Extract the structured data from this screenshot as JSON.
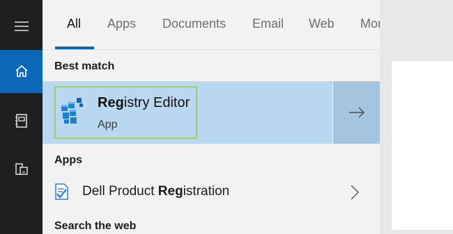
{
  "rail": {
    "items": [
      "menu-icon",
      "home-icon",
      "notebook-icon",
      "devices-icon"
    ]
  },
  "tabs": [
    {
      "label": "All"
    },
    {
      "label": "Apps"
    },
    {
      "label": "Documents"
    },
    {
      "label": "Email"
    },
    {
      "label": "Web"
    },
    {
      "label": "More"
    }
  ],
  "sections": {
    "best_match": "Best match",
    "apps": "Apps",
    "search_web": "Search the web"
  },
  "best_match": {
    "title_match": "Reg",
    "title_rest": "istry Editor",
    "subtitle": "App",
    "icon": "registry-editor-icon"
  },
  "apps": [
    {
      "prefix": "Dell Product ",
      "match": "Reg",
      "suffix": "istration",
      "icon": "dell-registration-icon"
    }
  ],
  "colors": {
    "accent": "#0b67b8",
    "selection": "#b9d7f1",
    "selection_arrow": "#a5c4e0",
    "focus_border": "#a6cf5e",
    "rail": "#1f1f1f"
  }
}
